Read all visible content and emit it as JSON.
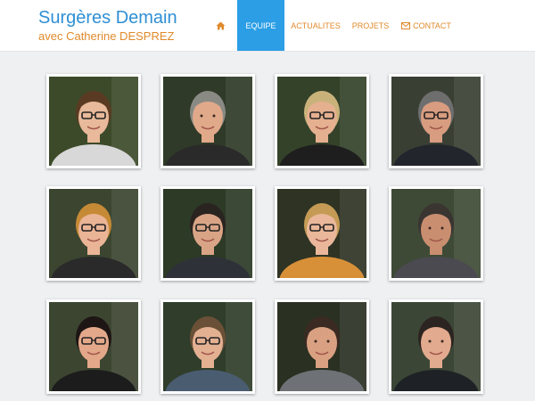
{
  "header": {
    "site_title": "Surgères Demain",
    "site_subtitle": "avec Catherine DESPREZ"
  },
  "nav": {
    "home_icon": "home-icon",
    "items": [
      {
        "label": "EQUIPE",
        "active": true
      },
      {
        "label": "ACTUALITES",
        "active": false
      },
      {
        "label": "PROJETS",
        "active": false
      },
      {
        "label": "CONTACT",
        "icon": "mail-icon",
        "active": false
      }
    ]
  },
  "colors": {
    "accent_blue": "#2b9ee6",
    "title_blue": "#2e8fd4",
    "accent_orange": "#e08a2c",
    "background": "#eef0f2"
  },
  "team": [
    {
      "hair": "#5a3a22",
      "skin": "#e8b99a",
      "top": "#d8d8d8",
      "bg": "#3c4a2a",
      "glasses": true
    },
    {
      "hair": "#8a8a84",
      "skin": "#e0a98a",
      "top": "#2a2a2a",
      "bg": "#2f3a28",
      "glasses": false
    },
    {
      "hair": "#c9b27a",
      "skin": "#e5b090",
      "top": "#1e1e1e",
      "bg": "#34422a",
      "glasses": true
    },
    {
      "hair": "#6e6e6e",
      "skin": "#d89c80",
      "top": "#22262c",
      "bg": "#3a3f34",
      "glasses": true
    },
    {
      "hair": "#c68a36",
      "skin": "#eab496",
      "top": "#2a2a2a",
      "bg": "#3b4530",
      "glasses": true
    },
    {
      "hair": "#2a2420",
      "skin": "#d9a486",
      "top": "#2e3238",
      "bg": "#2c3a26",
      "glasses": true
    },
    {
      "hair": "#c59a55",
      "skin": "#eab79a",
      "top": "#d89038",
      "bg": "#2e3324",
      "glasses": true
    },
    {
      "hair": "#3b3532",
      "skin": "#c98e70",
      "top": "#4a4a50",
      "bg": "#3e4a36",
      "glasses": false
    },
    {
      "hair": "#1e1614",
      "skin": "#e3a88a",
      "top": "#1c1c1c",
      "bg": "#3c4530",
      "glasses": true
    },
    {
      "hair": "#6a5036",
      "skin": "#e3b092",
      "top": "#4a5c70",
      "bg": "#2f3d2a",
      "glasses": true
    },
    {
      "hair": "#3a2a22",
      "skin": "#d9a082",
      "top": "#6e7276",
      "bg": "#2a3022",
      "glasses": false
    },
    {
      "hair": "#2c2420",
      "skin": "#e2aa8e",
      "top": "#1e2226",
      "bg": "#3c4636",
      "glasses": false
    }
  ]
}
